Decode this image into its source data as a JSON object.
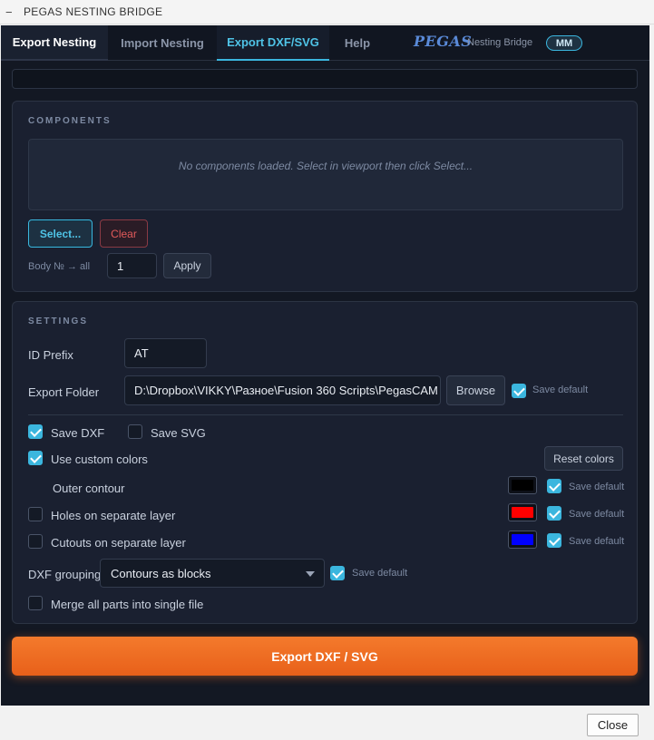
{
  "window": {
    "title": "PEGAS NESTING BRIDGE",
    "minimize_glyph": "−"
  },
  "tabs": [
    {
      "label": "Export Nesting"
    },
    {
      "label": "Import Nesting"
    },
    {
      "label": "Export DXF/SVG"
    },
    {
      "label": "Help"
    }
  ],
  "brand": {
    "logo": "PEGAS",
    "subtitle": "Nesting Bridge",
    "unit": "MM"
  },
  "components": {
    "heading": "COMPONENTS",
    "empty_text": "No components loaded. Select in viewport then click Select...",
    "select_label": "Select...",
    "clear_label": "Clear",
    "body_label": "Body № → all",
    "body_value": "1",
    "apply_label": "Apply"
  },
  "settings": {
    "heading": "SETTINGS",
    "id_prefix_label": "ID Prefix",
    "id_prefix_value": "AT",
    "export_folder_label": "Export Folder",
    "export_folder_value": "D:\\Dropbox\\VIKKY\\Разное\\Fusion 360 Scripts\\PegasCAM",
    "browse_label": "Browse",
    "save_default_label": "Save default",
    "save_dxf_label": "Save DXF",
    "save_dxf_checked": true,
    "save_svg_label": "Save SVG",
    "save_svg_checked": false,
    "use_custom_colors_label": "Use custom colors",
    "use_custom_colors_checked": true,
    "reset_colors_label": "Reset colors",
    "outer_contour_label": "Outer contour",
    "outer_contour_color": "#000000",
    "holes_label": "Holes on separate layer",
    "holes_checked": false,
    "holes_color": "#ff0000",
    "cutouts_label": "Cutouts on separate layer",
    "cutouts_checked": false,
    "cutouts_color": "#0000ff",
    "dxf_grouping_label": "DXF grouping",
    "dxf_grouping_value": "Contours as blocks",
    "merge_label": "Merge all parts into single file",
    "merge_checked": false
  },
  "export_button_label": "Export DXF / SVG",
  "close_label": "Close",
  "colors": {
    "accent": "#3bb6de",
    "export": "#f06e22",
    "danger": "#e25a5a",
    "background": "#131823"
  }
}
